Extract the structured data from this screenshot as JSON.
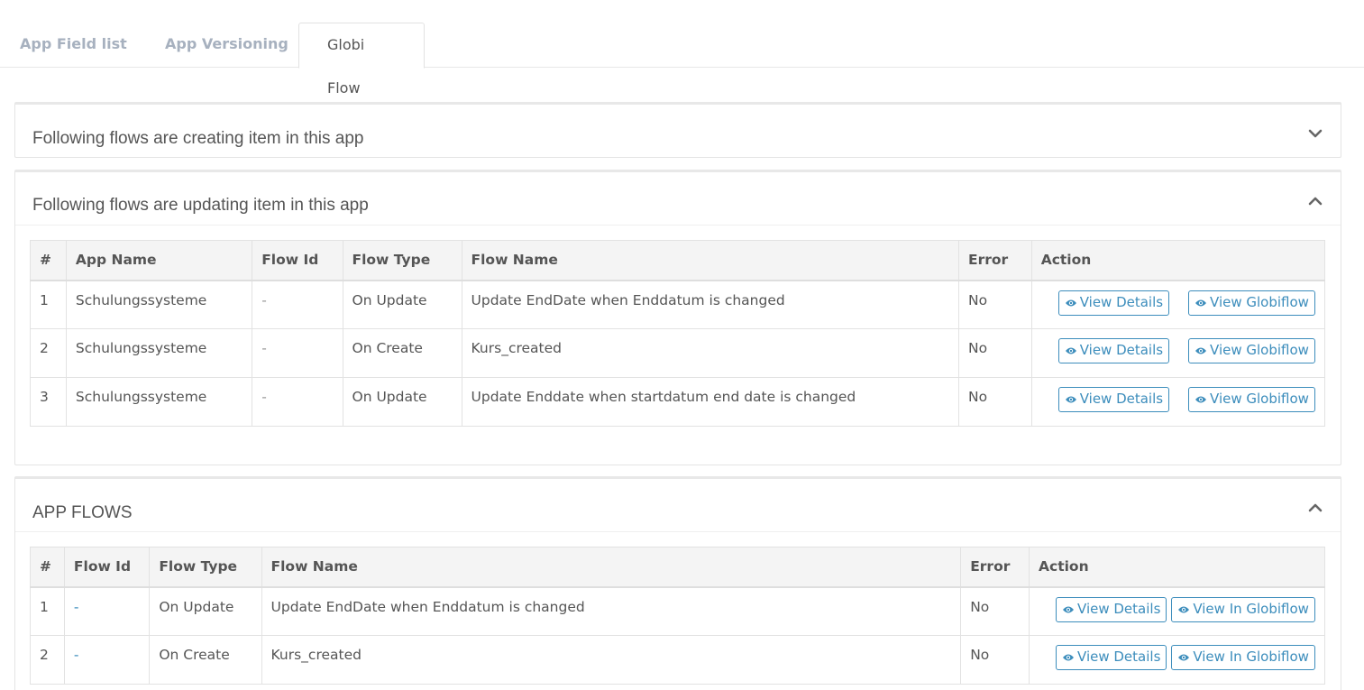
{
  "tabs": [
    {
      "label": "App Field list"
    },
    {
      "label": "App Versioning"
    },
    {
      "label": "Globi Flow"
    }
  ],
  "panel_creating": {
    "title": "Following flows are creating item in this app"
  },
  "panel_updating": {
    "title": "Following flows are updating item in this app",
    "columns": [
      "#",
      "App Name",
      "Flow Id",
      "Flow Type",
      "Flow Name",
      "Error",
      "Action"
    ],
    "rows": [
      {
        "num": "1",
        "app": "Schulungssysteme",
        "flow_id": "-",
        "type": "On Update",
        "name": "Update EndDate when Enddatum is changed",
        "error": "No",
        "btn1": "View Details",
        "btn2": "View Globiflow"
      },
      {
        "num": "2",
        "app": "Schulungssysteme",
        "flow_id": "-",
        "type": "On Create",
        "name": "Kurs_created",
        "error": "No",
        "btn1": "View Details",
        "btn2": "View Globiflow"
      },
      {
        "num": "3",
        "app": "Schulungssysteme",
        "flow_id": "-",
        "type": "On Update",
        "name": "Update Enddate when startdatum end date is changed",
        "error": "No",
        "btn1": "View Details",
        "btn2": "View Globiflow"
      }
    ]
  },
  "panel_app_flows": {
    "title": "APP FLOWS",
    "columns": [
      "#",
      "Flow Id",
      "Flow Type",
      "Flow Name",
      "Error",
      "Action"
    ],
    "rows": [
      {
        "num": "1",
        "flow_id": "-",
        "type": "On Update",
        "name": "Update EndDate when Enddatum is changed",
        "error": "No",
        "btn1": "View Details",
        "btn2": "View In Globiflow"
      },
      {
        "num": "2",
        "flow_id": "-",
        "type": "On Create",
        "name": "Kurs_created",
        "error": "No",
        "btn1": "View Details",
        "btn2": "View In Globiflow"
      }
    ]
  },
  "icons": {
    "view": "eye-icon",
    "collapsed": "chevron-down-icon",
    "expanded": "chevron-up-icon"
  },
  "colors": {
    "link": "#3c8dbc",
    "tab_inactive": "#a7b1bf",
    "header_bg": "#f4f4f4"
  }
}
